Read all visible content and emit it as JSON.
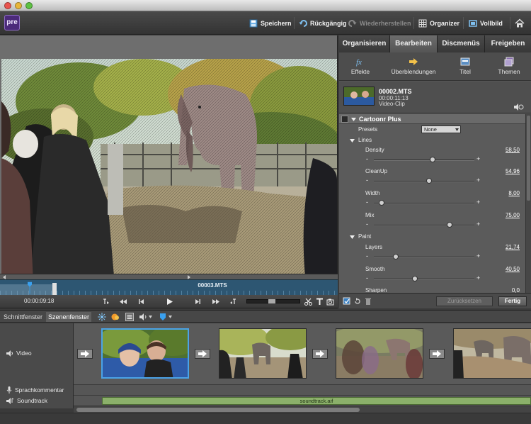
{
  "toolbar": {
    "logo": "pre",
    "save": "Speichern",
    "undo": "Rückgängig",
    "redo": "Wiederherstellen",
    "organizer": "Organizer",
    "fullscreen": "Vollbild"
  },
  "panel_tabs": [
    "Organisieren",
    "Bearbeiten",
    "Discmenüs",
    "Freigeben"
  ],
  "panel_subtabs": [
    "Effekte",
    "Überblendungen",
    "Titel",
    "Themen"
  ],
  "clip": {
    "name": "00002.MTS",
    "duration": "00:00:11:13",
    "type": "Video-Clip"
  },
  "effect": {
    "name": "Cartoonr Plus",
    "presets_label": "Presets",
    "presets_value": "None",
    "groups": {
      "lines": "Lines",
      "paint": "Paint"
    },
    "params": [
      {
        "label": "Density",
        "value": "58,50",
        "fraction": 0.585
      },
      {
        "label": "CleanUp",
        "value": "54,96",
        "fraction": 0.5496
      },
      {
        "label": "Width",
        "value": "8,00",
        "fraction": 0.08
      },
      {
        "label": "Mix",
        "value": "75,00",
        "fraction": 0.75
      },
      {
        "label": "Layers",
        "value": "21,74",
        "fraction": 0.2174
      },
      {
        "label": "Smooth",
        "value": "40,50",
        "fraction": 0.405
      },
      {
        "label": "Sharpen",
        "value": "0,0"
      }
    ],
    "minus": "-",
    "plus": "+"
  },
  "buttons": {
    "reset": "Zurücksetzen",
    "done": "Fertig"
  },
  "mini_timeline": {
    "clip_label": "00003.MTS",
    "timecode": "00:00:09:18"
  },
  "scene_tabs": [
    "Schnittfenster",
    "Szenenfenster"
  ],
  "tracks": {
    "video": "Video",
    "narration": "Sprachkommentar",
    "soundtrack": "Soundtrack"
  },
  "soundtrack_file": "soundtrack.aif"
}
